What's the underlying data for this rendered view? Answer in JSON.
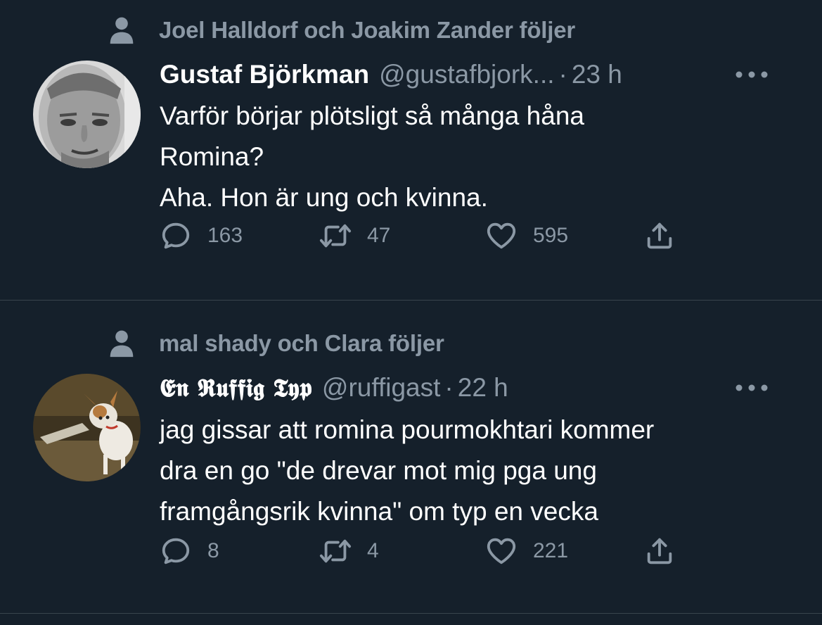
{
  "tweets": [
    {
      "social_context": "Joel Halldorf och Joakim Zander följer",
      "display_name": "Gustaf Björkman",
      "handle": "@gustafbjork...",
      "separator": "·",
      "time": "23 h",
      "text_lines": [
        "Varför börjar plötsligt så många håna",
        "Romina?",
        "Aha. Hon är ung och kvinna."
      ],
      "replies": "163",
      "retweets": "47",
      "likes": "595"
    },
    {
      "social_context": "mal shady och Clara följer",
      "display_name": "𝕰𝖓 𝕽𝖚𝖋𝖋𝖎𝖌 𝕿𝖞𝖕",
      "handle": "@ruffigast",
      "separator": "·",
      "time": "22 h",
      "text_lines": [
        "jag gissar att romina pourmokhtari kommer",
        "dra en go \"de drevar mot mig pga ung",
        "framgångsrik kvinna\" om typ en vecka"
      ],
      "replies": "8",
      "retweets": "4",
      "likes": "221"
    }
  ],
  "icons": {
    "social_context": "person-icon",
    "reply": "reply-icon",
    "retweet": "retweet-icon",
    "like": "heart-icon",
    "share": "share-icon",
    "more": "more-icon"
  },
  "colors": {
    "background": "#15202b",
    "secondary_text": "#8b98a5",
    "divider": "#38444d"
  }
}
